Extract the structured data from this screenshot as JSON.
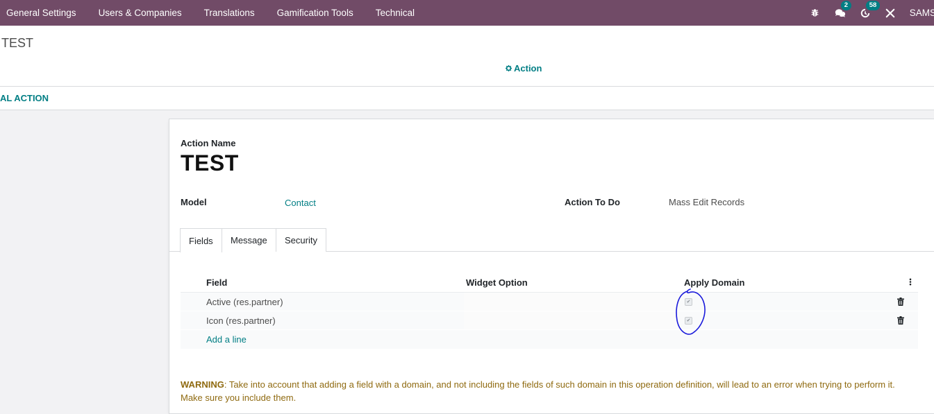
{
  "navbar": {
    "menu": [
      "General Settings",
      "Users & Companies",
      "Translations",
      "Gamification Tools",
      "Technical"
    ],
    "chat_count": "2",
    "activity_count": "58",
    "user": "SAMSA"
  },
  "control_panel": {
    "breadcrumb": "TEST",
    "action_label": "Action"
  },
  "statusbar": {
    "button_label": "AL ACTION"
  },
  "form": {
    "action_name_label": "Action Name",
    "action_name": "TEST",
    "model_label": "Model",
    "model_value": "Contact",
    "action_todo_label": "Action To Do",
    "action_todo_value": "Mass Edit Records"
  },
  "tabs": [
    "Fields",
    "Message",
    "Security"
  ],
  "table": {
    "columns": [
      "Field",
      "Widget Option",
      "Apply Domain"
    ],
    "rows": [
      {
        "field": "Active (res.partner)",
        "widget": "",
        "apply_domain": true
      },
      {
        "field": "Icon (res.partner)",
        "widget": "",
        "apply_domain": true
      }
    ],
    "add_line": "Add a line"
  },
  "warning": {
    "label": "WARNING",
    "text": ": Take into account that adding a field with a domain, and not including the fields of such domain in this operation definition, will lead to an error when trying to perform it. Make sure you include them."
  },
  "colors": {
    "navbar": "#714b67",
    "accent": "#017e84",
    "warning": "#8f6a10",
    "annotation": "#1a1adb"
  }
}
